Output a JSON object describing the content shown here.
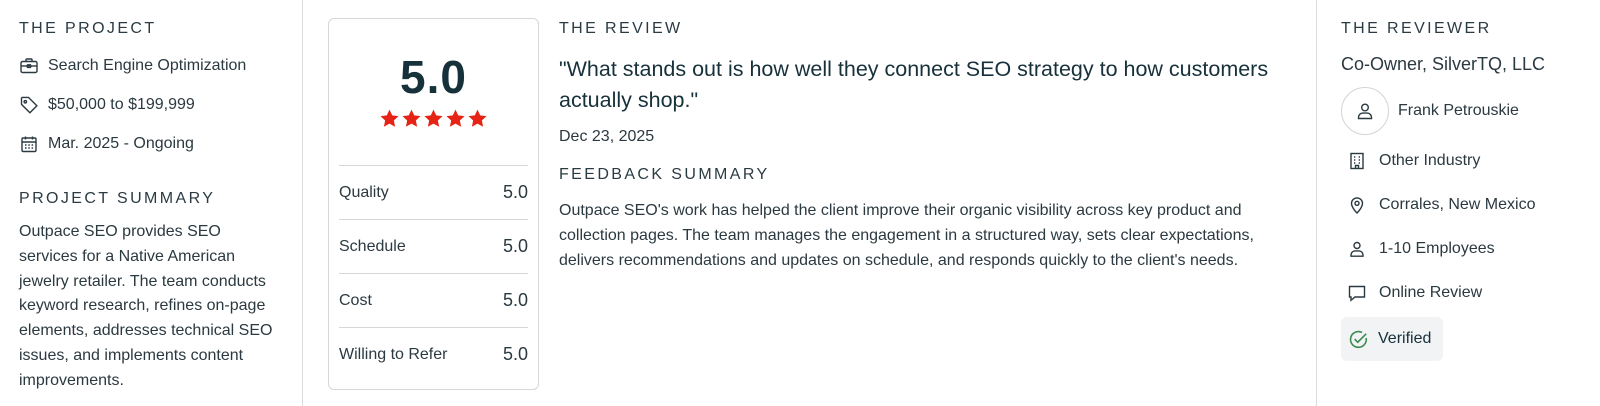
{
  "project": {
    "title": "THE PROJECT",
    "service": "Search Engine Optimization",
    "budget": "$50,000 to $199,999",
    "dates": "Mar. 2025 - Ongoing",
    "summary_title": "PROJECT SUMMARY",
    "summary": "Outpace SEO provides SEO services for a Native American jewelry retailer. The team conducts keyword research, refines on-page elements, addresses technical SEO issues, and implements content improvements."
  },
  "rating": {
    "overall": "5.0",
    "stars": 5,
    "star_color": "#e62415",
    "rows": [
      {
        "label": "Quality",
        "value": "5.0"
      },
      {
        "label": "Schedule",
        "value": "5.0"
      },
      {
        "label": "Cost",
        "value": "5.0"
      },
      {
        "label": "Willing to Refer",
        "value": "5.0"
      }
    ]
  },
  "review": {
    "title": "THE REVIEW",
    "quote": "\"What stands out is how well they connect SEO strategy to how customers actually shop.\"",
    "date": "Dec 23, 2025",
    "feedback_title": "FEEDBACK SUMMARY",
    "feedback": "Outpace SEO's work has helped the client improve their organic visibility across key product and collection pages. The team manages the engagement in a structured way, sets clear expectations, delivers recommendations and updates on schedule, and responds quickly to the client's needs."
  },
  "reviewer": {
    "title": "THE REVIEWER",
    "role": "Co-Owner, SilverTQ, LLC",
    "name": "Frank Petrouskie",
    "industry": "Other Industry",
    "location": "Corrales, New Mexico",
    "employees": "1-10 Employees",
    "review_type": "Online Review",
    "verified": "Verified",
    "verified_color": "#3a8a4e"
  },
  "icons": {
    "service": "briefcase-icon",
    "budget": "price-tag-icon",
    "dates": "calendar-icon",
    "avatar": "user-icon",
    "industry": "building-icon",
    "location": "location-pin-icon",
    "employees": "person-icon",
    "review_type": "chat-bubble-icon",
    "verified": "check-circle-icon",
    "star": "star-icon"
  }
}
